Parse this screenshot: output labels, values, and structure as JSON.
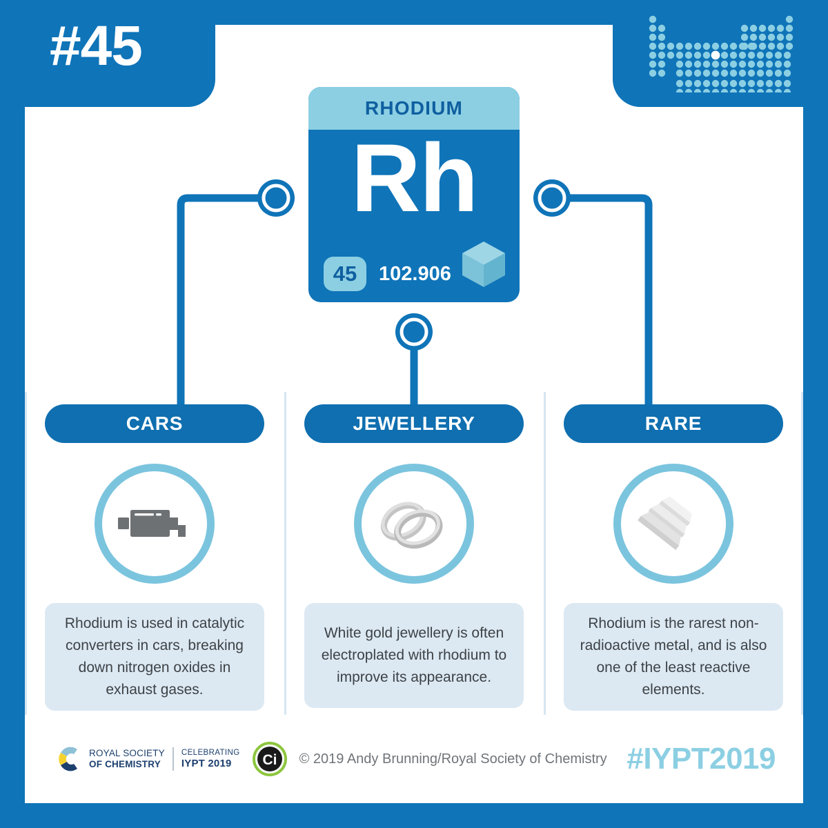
{
  "header": {
    "number_label": "#45",
    "periodic_table_icon": "periodic-table-dots-icon",
    "highlight_position": "rhodium"
  },
  "element_card": {
    "name": "RHODIUM",
    "symbol": "Rh",
    "atomic_number": "45",
    "atomic_mass": "102.906",
    "state_icon": "solid-cube-icon"
  },
  "sections": [
    {
      "key": "cars",
      "title": "CARS",
      "icon": "catalytic-converter-icon",
      "description": "Rhodium is used in catalytic converters in cars, breaking down nitrogen oxides in exhaust gases."
    },
    {
      "key": "jewellery",
      "title": "JEWELLERY",
      "icon": "wedding-rings-icon",
      "description": "White gold jewellery is often electroplated with rhodium to improve its appearance."
    },
    {
      "key": "rare",
      "title": "RARE",
      "icon": "metal-ingots-icon",
      "description": "Rhodium is the rarest non-radioactive metal, and is also one of the least reactive elements."
    }
  ],
  "footer": {
    "rsc_line1": "ROYAL SOCIETY",
    "rsc_line2": "OF CHEMISTRY",
    "iypt_line1": "CELEBRATING",
    "iypt_line2": "IYPT 2019",
    "ci_label": "Ci",
    "copyright": "© 2019 Andy Brunning/Royal Society of Chemistry",
    "hashtag": "#IYPT2019"
  },
  "colors": {
    "brand_blue": "#0f74b8",
    "deep_blue": "#0f6fb0",
    "light_blue": "#8ccfe3",
    "ring_blue": "#7bc4de",
    "card_bg": "#dce9f3",
    "divider": "#d6e6f2",
    "text_gray": "#3d4246",
    "footer_gray": "#6f7479",
    "icon_gray": "#6e7174",
    "silver": "#cfcfcf"
  }
}
